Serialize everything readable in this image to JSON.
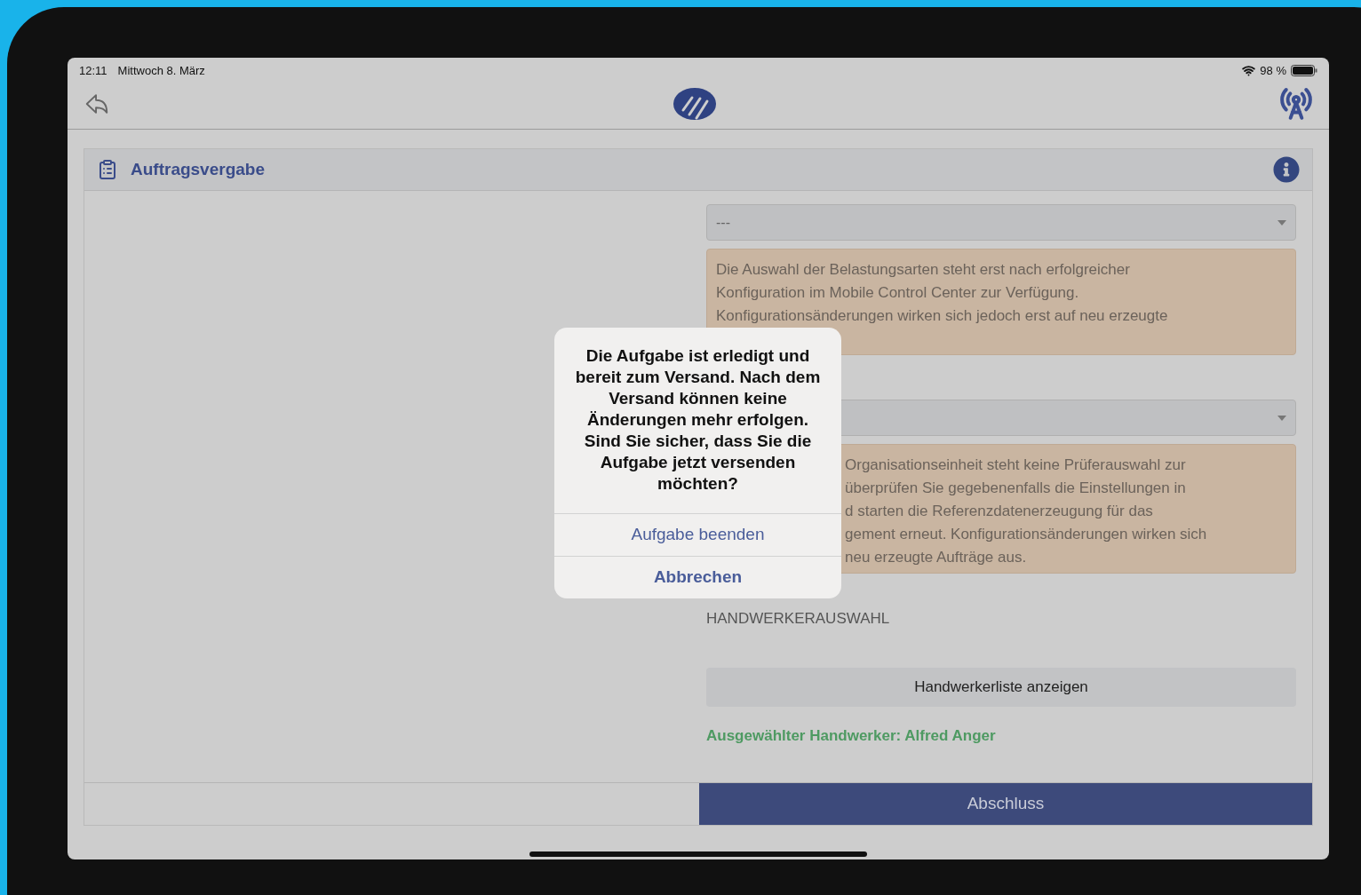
{
  "status_bar": {
    "time": "12:11",
    "date": "Mittwoch 8. März",
    "battery": "98 %"
  },
  "card": {
    "title": "Auftragsvergabe"
  },
  "form": {
    "select_1": {
      "value": "---"
    },
    "notice_1": [
      "Die Auswahl der Belastungsarten steht erst nach erfolgreicher",
      "Konfiguration im Mobile Control Center zur Verfügung.",
      "Konfigurationsänderungen wirken sich jedoch erst auf neu erzeugte"
    ],
    "notice_2": [
      "Organisationseinheit steht keine Prüferauswahl zur",
      "überprüfen Sie gegebenenfalls die Einstellungen in",
      "d starten die Referenzdatenerzeugung für das",
      "gement erneut. Konfigurationsänderungen wirken sich",
      "neu erzeugte Aufträge aus."
    ],
    "section_label": "HANDWERKERAUSWAHL",
    "list_button": "Handwerkerliste anzeigen",
    "selected_craftsman": "Ausgewählter Handwerker: Alfred Anger"
  },
  "footer": {
    "submit": "Abschluss"
  },
  "dialog": {
    "message": "Die Aufgabe ist erledigt und bereit zum Versand. Nach dem Versand können keine Änderungen mehr erfolgen. Sind Sie sicher, dass Sie die Aufgabe jetzt versenden möchten?",
    "actions": [
      {
        "label": "Aufgabe beenden",
        "kind": "default"
      },
      {
        "label": "Abbrechen",
        "kind": "cancel"
      }
    ]
  }
}
